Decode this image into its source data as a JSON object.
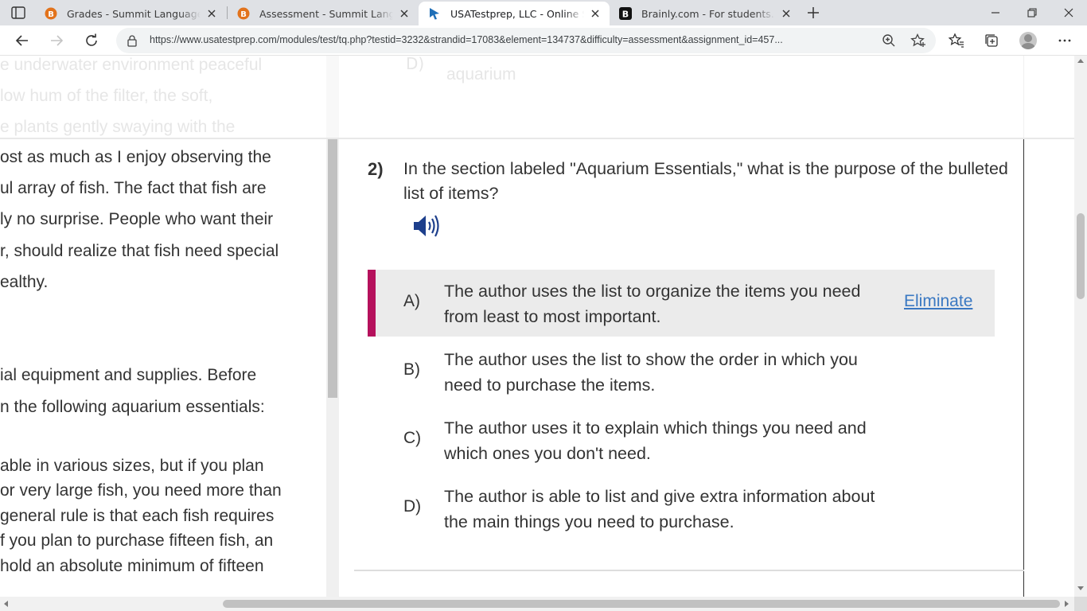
{
  "browser": {
    "tabs": [
      {
        "title": "Grades - Summit Language Arts",
        "favicon": "buzz-icon",
        "active": false
      },
      {
        "title": "Assessment - Summit Language",
        "favicon": "buzz-icon",
        "active": false
      },
      {
        "title": "USATestprep, LLC - Online State-",
        "favicon": "usatestprep-cursor-icon",
        "active": true
      },
      {
        "title": "Brainly.com - For students. By stu",
        "favicon": "brainly-icon",
        "active": false
      }
    ],
    "url": "https://www.usatestprep.com/modules/test/tq.php?testid=3232&strandid=17083&element=134737&difficulty=assessment&assignment_id=457..."
  },
  "passage": {
    "faded_lines": [
      "e underwater environment peaceful",
      " low hum of the filter, the soft,",
      "e plants gently swaying with the"
    ],
    "lines": [
      "ost as much as I enjoy observing the",
      "ul array of fish. The fact that fish are",
      "ly no surprise. People who want their",
      "r, should realize that fish need special",
      "ealthy.",
      "ial equipment and supplies. Before",
      "n the following aquarium essentials:",
      "able in various sizes, but if you plan",
      "or very large fish, you need more than",
      "general rule is that each fish requires",
      "f you plan to purchase fifteen fish, an",
      "hold an absolute minimum of fifteen"
    ]
  },
  "previous_question": {
    "letter": "D)",
    "text": "aquarium"
  },
  "question": {
    "number": "2)",
    "text": "In the section labeled \"Aquarium Essentials,\" what is the purpose of the bulleted list of items?",
    "choices": [
      {
        "letter": "A)",
        "text": "The author uses the list to organize the items you need from least to most important.",
        "selected": true
      },
      {
        "letter": "B)",
        "text": "The author uses the list to show the order in which you need to purchase the items.",
        "selected": false
      },
      {
        "letter": "C)",
        "text": "The author uses it to explain which things you need and which ones you don't need.",
        "selected": false
      },
      {
        "letter": "D)",
        "text": "The author is able to list and give extra information about the main things you need to purchase.",
        "selected": false
      }
    ],
    "eliminate_label": "Eliminate"
  },
  "colors": {
    "selected_bar": "#b5115c",
    "link": "#3a78c2",
    "selected_bg": "#ebebeb",
    "speaker": "#1d3f8c"
  }
}
